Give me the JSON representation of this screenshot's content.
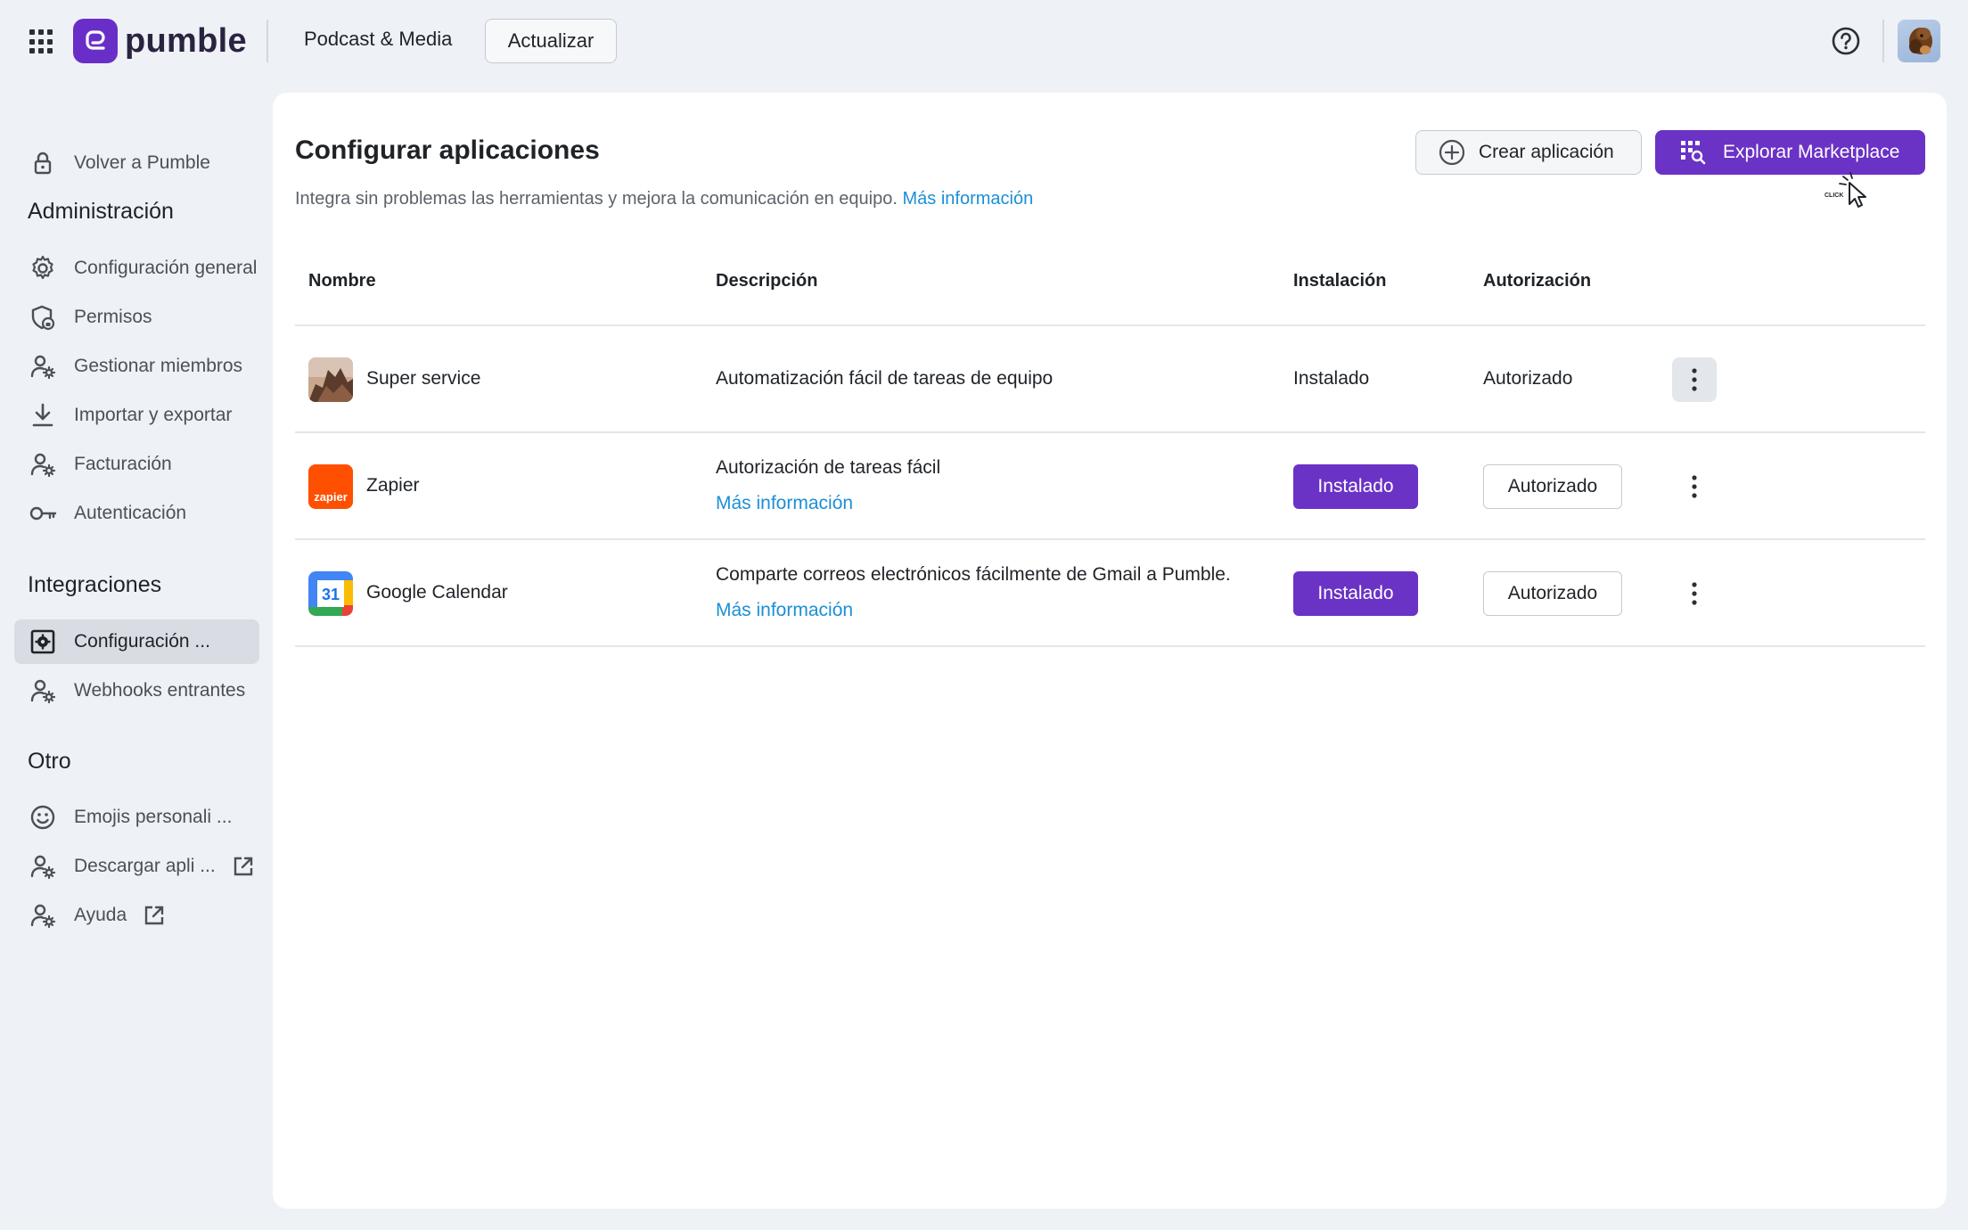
{
  "topbar": {
    "logo_text": "pumble",
    "workspace": "Podcast & Media",
    "upgrade_label": "Actualizar",
    "icons": [
      "apps-grid-icon",
      "help-icon",
      "avatar"
    ]
  },
  "sidebar": {
    "back_label": "Volver a Pumble",
    "admin_heading": "Administración",
    "admin_items": [
      {
        "label": "Configuración general",
        "icon": "gear-icon"
      },
      {
        "label": "Permisos",
        "icon": "shield-lock-icon"
      },
      {
        "label": "Gestionar miembros",
        "icon": "user-gear-icon"
      },
      {
        "label": "Importar y exportar",
        "icon": "download-icon"
      },
      {
        "label": "Facturación",
        "icon": "user-gear-icon"
      },
      {
        "label": "Autenticación",
        "icon": "key-icon"
      }
    ],
    "integrations_heading": "Integraciones",
    "integration_items": [
      {
        "label": "Configuración ...",
        "icon": "app-gear-icon",
        "active": true
      },
      {
        "label": "Webhooks entrantes",
        "icon": "user-gear-icon"
      }
    ],
    "other_heading": "Otro",
    "other_items": [
      {
        "label": "Emojis personali ...",
        "icon": "smiley-icon"
      },
      {
        "label": "Descargar apli ...",
        "icon": "user-gear-icon",
        "external": true
      },
      {
        "label": "Ayuda",
        "icon": "user-gear-icon",
        "external": true
      }
    ]
  },
  "main": {
    "title": "Configurar aplicaciones",
    "subtitle": "Integra sin problemas las herramientas y mejora la comunicación en equipo.",
    "subtitle_link": "Más información",
    "create_button": "Crear aplicación",
    "marketplace_button": "Explorar Marketplace",
    "cursor_label": "CLICK",
    "table": {
      "headers": [
        "Nombre",
        "Descripción",
        "Instalación",
        "Autorización"
      ],
      "rows": [
        {
          "name": "Super service",
          "description": "Automatización fácil de tareas de equipo",
          "link": "",
          "installation": "Instalado",
          "authorization": "Autorizado"
        },
        {
          "name": "Zapier",
          "icon_text": "zapier",
          "description": "Autorización de tareas fácil",
          "link": "Más información",
          "installation": "Instalado",
          "authorization": "Autorizado"
        },
        {
          "name": "Google Calendar",
          "icon_text": "31",
          "description": "Comparte correos electrónicos fácilmente de Gmail a Pumble.",
          "link": "Más información",
          "installation": "Instalado",
          "authorization": "Autorizado"
        }
      ]
    }
  },
  "colors": {
    "brand": "#6a32c5",
    "link": "#1c8fd6",
    "background": "#eef1f5",
    "zapier": "#ff4f00"
  }
}
